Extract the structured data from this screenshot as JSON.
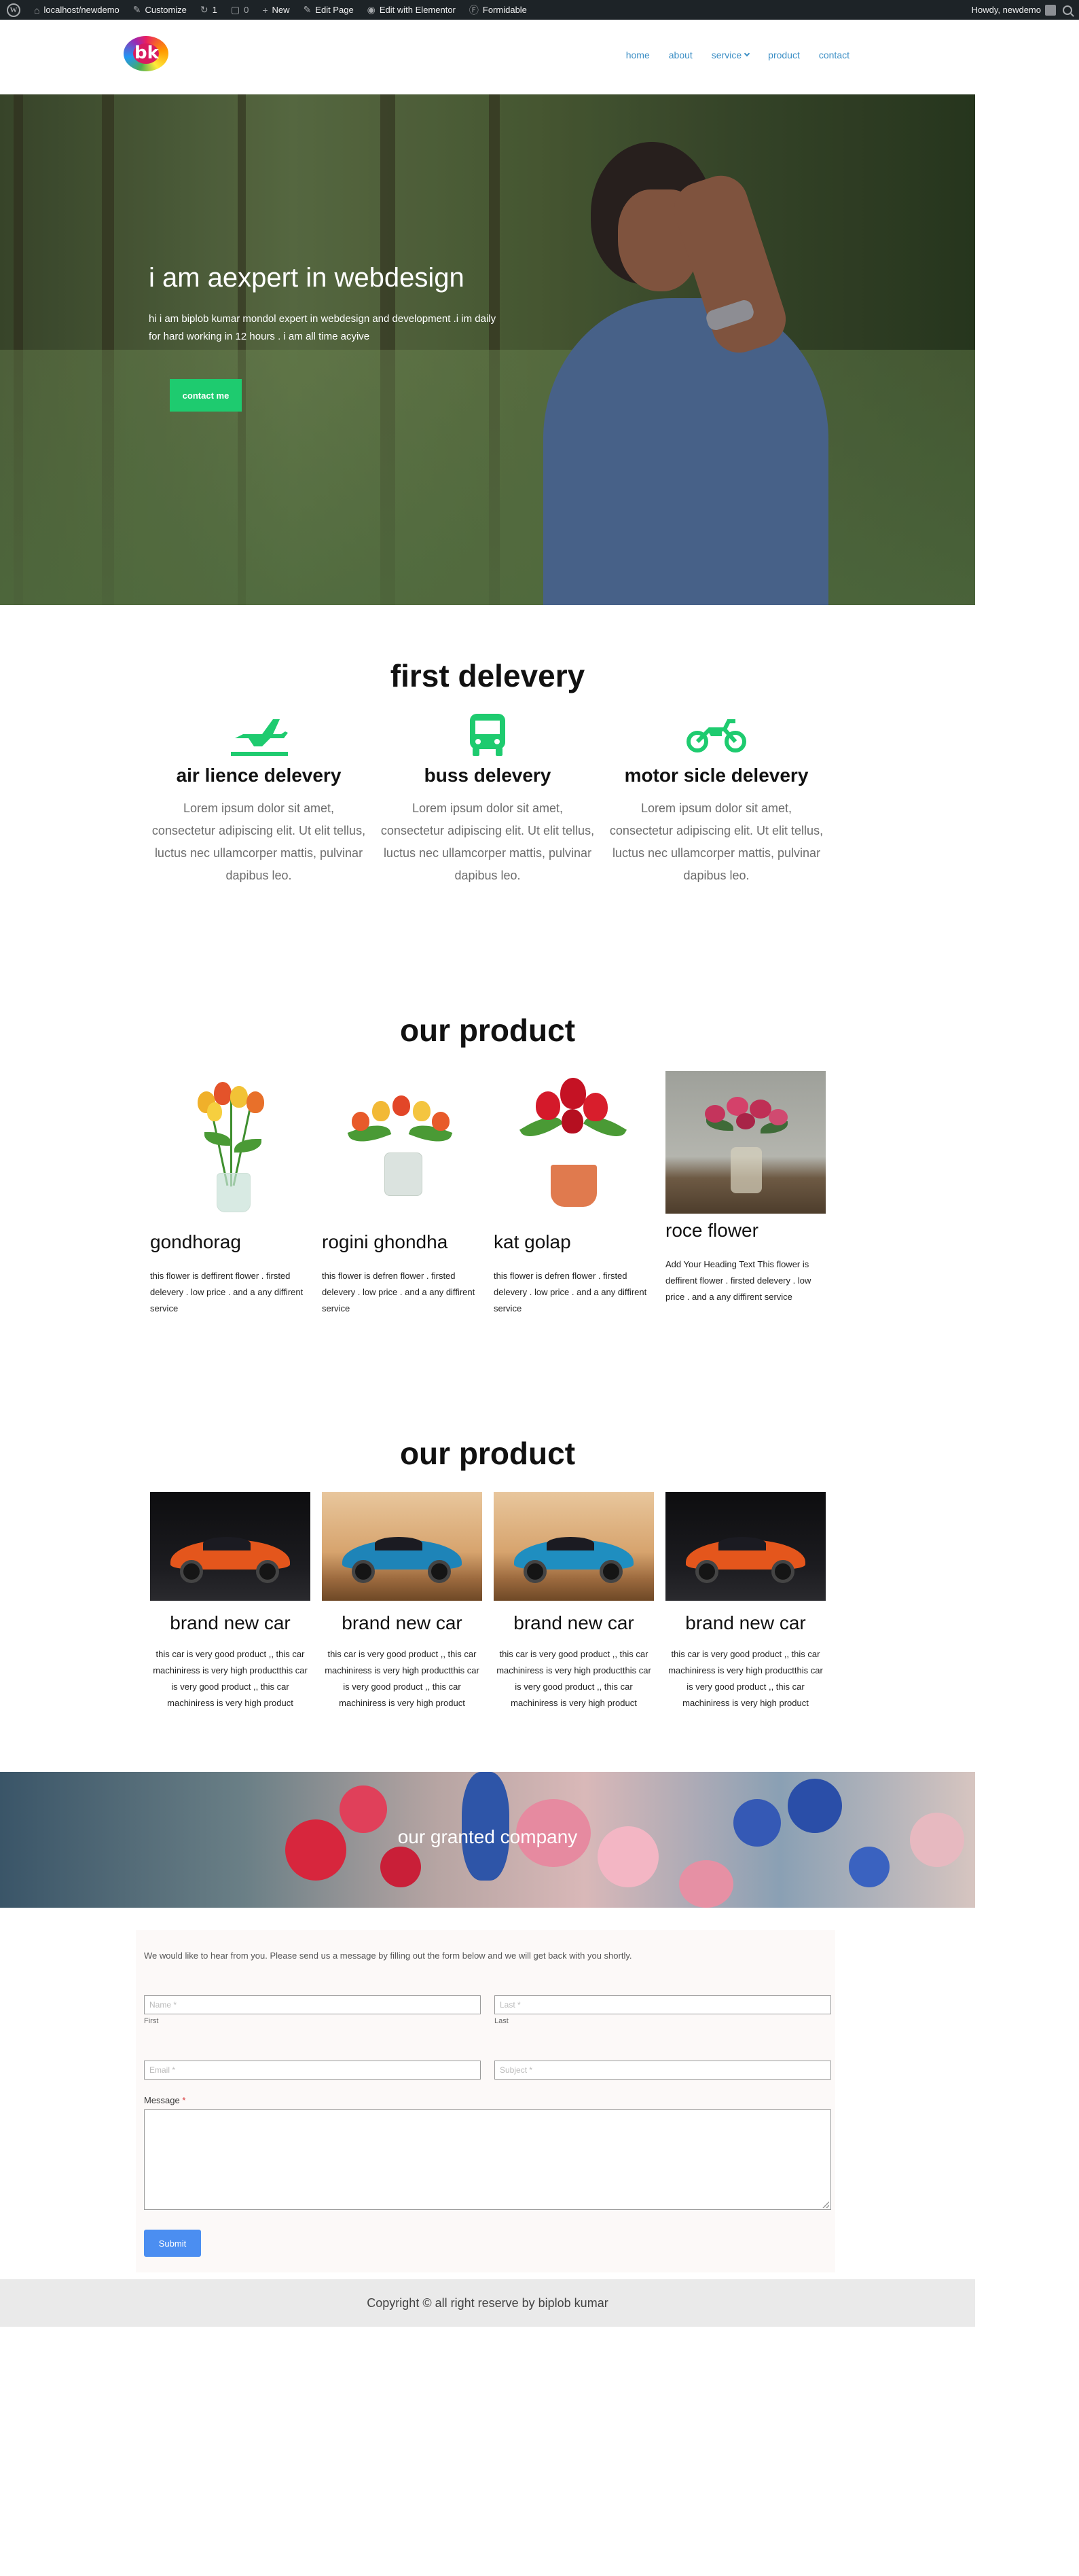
{
  "adminbar": {
    "site": "localhost/newdemo",
    "customize": "Customize",
    "updates": "1",
    "comments": "0",
    "new": "New",
    "edit_page": "Edit Page",
    "elementor": "Edit with Elementor",
    "formidable": "Formidable",
    "howdy": "Howdy, newdemo"
  },
  "header": {
    "logo_text": "bk",
    "nav": [
      "home",
      "about",
      "service",
      "product",
      "contact"
    ]
  },
  "hero": {
    "title": "i am aexpert in webdesign",
    "text": "hi i am biplob kumar mondol expert in webdesign and development .i im daily for hard working in 12 hours . i am all time acyive",
    "button": "contact me"
  },
  "delivery": {
    "title": "first delevery",
    "items": [
      {
        "icon": "plane-icon",
        "title": "air lience delevery",
        "text": "Lorem ipsum dolor sit amet, consectetur adipiscing elit. Ut elit tellus, luctus nec ullamcorper mattis, pulvinar dapibus leo."
      },
      {
        "icon": "bus-icon",
        "title": "buss delevery",
        "text": "Lorem ipsum dolor sit amet, consectetur adipiscing elit. Ut elit tellus, luctus nec ullamcorper mattis, pulvinar dapibus leo."
      },
      {
        "icon": "motorcycle-icon",
        "title": "motor sicle delevery",
        "text": "Lorem ipsum dolor sit amet, consectetur adipiscing elit. Ut elit tellus, luctus nec ullamcorper mattis, pulvinar dapibus leo."
      }
    ],
    "accent": "#1ecb6f"
  },
  "products": {
    "title": "our product",
    "items": [
      {
        "name": "gondhorag",
        "desc": "this flower is deffirent flower . firsted delevery . low price . and a any diffirent service"
      },
      {
        "name": "rogini ghondha",
        "desc": "this flower is defren flower . firsted delevery . low price . and a any diffirent service"
      },
      {
        "name": "kat golap",
        "desc": "this flower is defren flower . firsted delevery . low price . and a any diffirent service"
      },
      {
        "name": "roce flower",
        "desc": "Add Your Heading Text This flower is deffirent flower . firsted delevery . low price . and a any diffirent service"
      }
    ]
  },
  "cars": {
    "title": "our product",
    "items": [
      {
        "title": "brand new car",
        "desc": "this car is very good product ,, this car machiniress is very high productthis car is very good product ,, this car machiniress is very high product"
      },
      {
        "title": "brand new car",
        "desc": "this car is very good product ,, this car machiniress is very high productthis car is very good product ,, this car machiniress is very high product"
      },
      {
        "title": "brand new car",
        "desc": "this car is very good product ,, this car machiniress is very high productthis car is very good product ,, this car machiniress is very high product"
      },
      {
        "title": "brand new car",
        "desc": "this car is very good product ,, this car machiniress is very high productthis car is very good product ,, this car machiniress is very high product"
      }
    ]
  },
  "banner": {
    "title": "our granted company"
  },
  "form": {
    "intro": "We would like to hear from you. Please send us a message by filling out the form below and we will get back with you shortly.",
    "first_placeholder": "Name *",
    "first_sub": "First",
    "last_placeholder": "Last *",
    "last_sub": "Last",
    "email_placeholder": "Email *",
    "subject_placeholder": "Subject *",
    "message_label": "Message",
    "required_mark": "*",
    "submit": "Submit"
  },
  "footer": {
    "copyright": "Copyright ©  all right reserve by biplob kumar"
  }
}
